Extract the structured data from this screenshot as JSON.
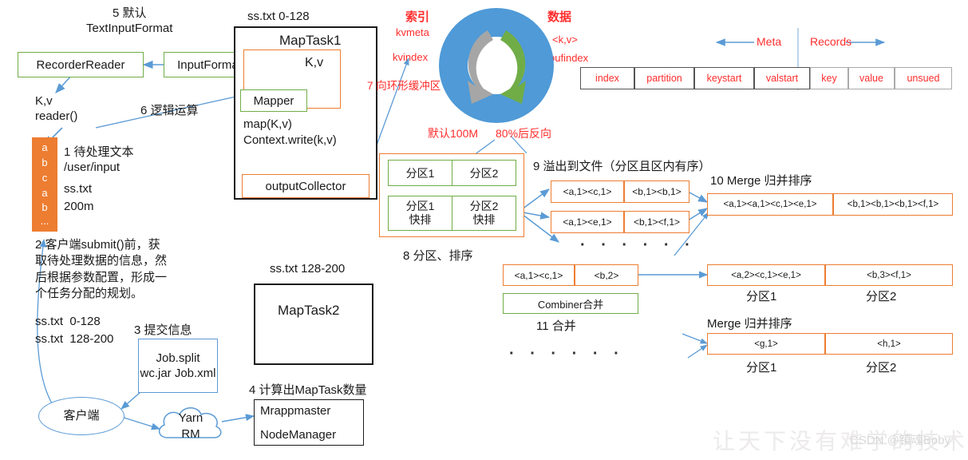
{
  "diagram": {
    "title": "MapReduce MapTask Shuffle Flow",
    "colors": {
      "green": "#70ad47",
      "orange": "#ed7d31",
      "blue": "#5b9bd5",
      "red": "#ff2d2d",
      "black": "#1a1a1a",
      "gray_arrow": "#a6a6a6",
      "green_arrow": "#70ad47",
      "ring": "#4f9ad7"
    }
  },
  "left": {
    "step5": "5 默认\nTextInputFormat",
    "recorder_reader": "RecorderReader",
    "input_format": "InputFormat",
    "kv_reader": "K,v\nreader()",
    "step6": "6 逻辑运算",
    "file_block_letters": [
      "a",
      "b",
      "c",
      "a",
      "b",
      "..."
    ],
    "step1": "1 待处理文本\n/user/input",
    "file_name": "ss.txt",
    "file_size": "200m",
    "step2": "2 客户端submit()前，获\n取待处理数据的信息，然\n后根据参数配置，形成一\n个任务分配的规划。",
    "split1": "ss.txt  0-128",
    "split2": "ss.txt  128-200",
    "step3": "3 提交信息",
    "job_files": "Job.split\nwc.jar\nJob.xml",
    "client": "客户端",
    "yarn": "Yarn\nRM",
    "step4": "4 计算出MapTask数量",
    "mrappmaster": "Mrappmaster",
    "nodemanager": "NodeManager"
  },
  "maptask1": {
    "split_label": "ss.txt 0-128",
    "title": "MapTask1",
    "kv": "K,v",
    "mapper": "Mapper",
    "map_calls": "map(K,v)\nContext.write(k,v)",
    "output_collector": "outputCollector"
  },
  "maptask2": {
    "split_label": "ss.txt 128-200",
    "title": "MapTask2"
  },
  "buffer": {
    "index_title": "索引",
    "kvmeta": "kvmeta",
    "kvindex": "kvindex",
    "data_title": "数据",
    "kv": "<k,v>",
    "bufindex": "bufindex",
    "step7": "7 向环形缓冲区\n写入<k,v>数据",
    "default_size": "默认100M",
    "spill_threshold": "80%后反向"
  },
  "meta_table": {
    "meta_label": "Meta",
    "records_label": "Records",
    "meta_cells": [
      "index",
      "partition",
      "keystart",
      "valstart"
    ],
    "record_cells": [
      "key",
      "value",
      "unsued"
    ]
  },
  "partitions": {
    "step8": "8 分区、排序",
    "row1": [
      "分区1",
      "分区2"
    ],
    "row2": [
      "分区1\n快排",
      "分区2\n快排"
    ]
  },
  "spill": {
    "step9": "9 溢出到文件（分区且区内有序）",
    "file1": [
      "<a,1><c,1>",
      "<b,1><b,1>"
    ],
    "file2": [
      "<a,1><e,1>",
      "<b,1><f,1>"
    ],
    "ellipsis": "· · ·   · · ·"
  },
  "merge": {
    "step10": "10 Merge 归并排序",
    "row": [
      "<a,1><a,1><c,1><e,1>",
      "<b,1><b,1><b,1><f,1>"
    ]
  },
  "combiner": {
    "row": [
      "<a,1><c,1>",
      "<b,2>"
    ],
    "label": "Combiner合并",
    "step11": "11 合并",
    "ellipsis": "· · ·   · · ·"
  },
  "result1": {
    "row": [
      "<a,2><c,1><e,1>",
      "<b,3><f,1>"
    ],
    "captions": [
      "分区1",
      "分区2"
    ]
  },
  "result2": {
    "title": "Merge 归并排序",
    "row": [
      "<g,1>",
      "<h,1>"
    ],
    "captions": [
      "分区1",
      "分区2"
    ]
  },
  "watermark": {
    "slogan": "让天下没有难学的技术",
    "credit": "CSDN @镇魂Boby"
  }
}
